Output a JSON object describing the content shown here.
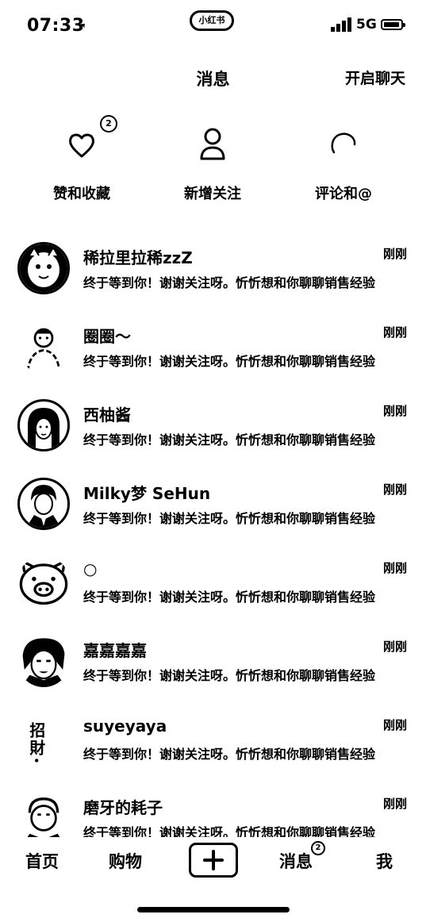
{
  "status": {
    "time": "07:33",
    "network": "5G",
    "pill": "小红书"
  },
  "header": {
    "title": "消息",
    "start_chat": "开启聊天"
  },
  "categories": [
    {
      "label": "赞和收藏",
      "icon": "heart-icon",
      "badge": "2"
    },
    {
      "label": "新增关注",
      "icon": "person-icon"
    },
    {
      "label": "评论和@",
      "icon": "comment-icon"
    }
  ],
  "messages": [
    {
      "name": "稀拉里拉稀zzZ",
      "time": "刚刚",
      "preview": "终于等到你！谢谢关注呀。忻忻想和你聊聊销售经验"
    },
    {
      "name": "圈圈～",
      "time": "刚刚",
      "preview": "终于等到你！谢谢关注呀。忻忻想和你聊聊销售经验"
    },
    {
      "name": "西柚酱",
      "time": "刚刚",
      "preview": "终于等到你！谢谢关注呀。忻忻想和你聊聊销售经验"
    },
    {
      "name": "Milky梦 SeHun",
      "time": "刚刚",
      "preview": "终于等到你！谢谢关注呀。忻忻想和你聊聊销售经验"
    },
    {
      "name": "○",
      "time": "刚刚",
      "preview": "终于等到你！谢谢关注呀。忻忻想和你聊聊销售经验"
    },
    {
      "name": "嘉嘉嘉嘉",
      "time": "刚刚",
      "preview": "终于等到你！谢谢关注呀。忻忻想和你聊聊销售经验"
    },
    {
      "name": "suyeyaya",
      "time": "刚刚",
      "preview": "终于等到你！谢谢关注呀。忻忻想和你聊聊销售经验"
    },
    {
      "name": "磨牙的耗子",
      "time": "刚刚",
      "preview": "终于等到你！谢谢关注呀。忻忻想和你聊聊销售经验"
    }
  ],
  "avatar_text": {
    "suyeyaya": "招財。"
  },
  "tabbar": {
    "home": "首页",
    "shop": "购物",
    "messages": "消息",
    "messages_badge": "2",
    "me": "我"
  }
}
